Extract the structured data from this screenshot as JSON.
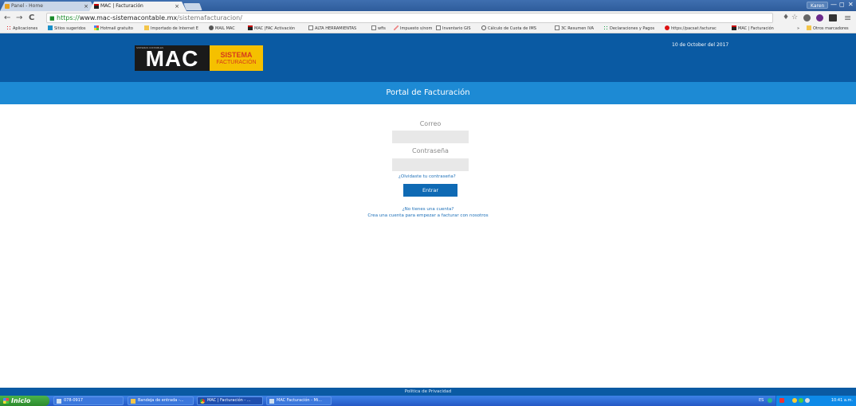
{
  "browser": {
    "tabs": [
      {
        "label": "Panel - Home",
        "active": false
      },
      {
        "label": "MAC | Facturación",
        "active": true
      }
    ],
    "profile_name": "Karen",
    "window_controls": {
      "minimize": "—",
      "maximize": "◻",
      "close": "✕"
    },
    "nav": {
      "back": "←",
      "forward": "→",
      "reload": "C"
    },
    "url": {
      "scheme": "https://",
      "host": "www.mac-sistemacontable.mx",
      "path": "/sistemafacturacion/"
    },
    "right_icons": {
      "key": "♦",
      "star": "☆",
      "menu": "≡"
    }
  },
  "bookmarks": [
    {
      "label": "Aplicaciones",
      "icon": "apps-icon"
    },
    {
      "label": "Sitios sugeridos",
      "icon": "bing-icon"
    },
    {
      "label": "Hotmail gratuito",
      "icon": "windows-icon"
    },
    {
      "label": "Importado de Internet E",
      "icon": "folder-icon"
    },
    {
      "label": "MAIL MAC",
      "icon": "mail-icon"
    },
    {
      "label": "MAC |FAC Activación",
      "icon": "mac-icon"
    },
    {
      "label": "ALTA HERRAMIENTAS",
      "icon": "page-icon"
    },
    {
      "label": "wfis",
      "icon": "page-icon"
    },
    {
      "label": "Impuesto s/nom",
      "icon": "pencil-icon"
    },
    {
      "label": "Inventario GIS",
      "icon": "page-icon"
    },
    {
      "label": "Cálculo de Cuota de IMS",
      "icon": "info-icon"
    },
    {
      "label": "3C Resumen IVA",
      "icon": "page-icon"
    },
    {
      "label": "Declaraciones y Pagos",
      "icon": "sat-icon"
    },
    {
      "label": "https://pacsat.facturac",
      "icon": "red-dot-icon"
    },
    {
      "label": "MAC | Facturación",
      "icon": "mac-icon"
    }
  ],
  "bookmarks_overflow": "»",
  "bookmarks_other": "Otros marcadores",
  "header": {
    "logo_main": "MAC",
    "logo_tag": "SISTEMAS CONTABLES",
    "logo_line1": "SISTEMA",
    "logo_line2": "FACTURACIÓN",
    "date": "10 de October del 2017"
  },
  "page_title": "Portal de Facturación",
  "form": {
    "email_label": "Correo",
    "email_value": "",
    "password_label": "Contraseña",
    "password_value": "",
    "forgot_link": "¿Olvidaste tu contraseña?",
    "submit_label": "Entrar",
    "no_account_text": "¿No tienes una cuenta?",
    "signup_link": "Crea una cuenta para empezar a facturar con nosotros"
  },
  "footer": {
    "privacy_link": "Politica de Privacidad"
  },
  "taskbar": {
    "start_label": "Inicio",
    "tasks": [
      {
        "label": "078-0917"
      },
      {
        "label": "Bandeja de entrada -..."
      },
      {
        "label": "MAC | Facturación - ..."
      },
      {
        "label": "MAC Facturación - Mi..."
      }
    ],
    "language": "ES",
    "clock": "10:41 a.m."
  }
}
